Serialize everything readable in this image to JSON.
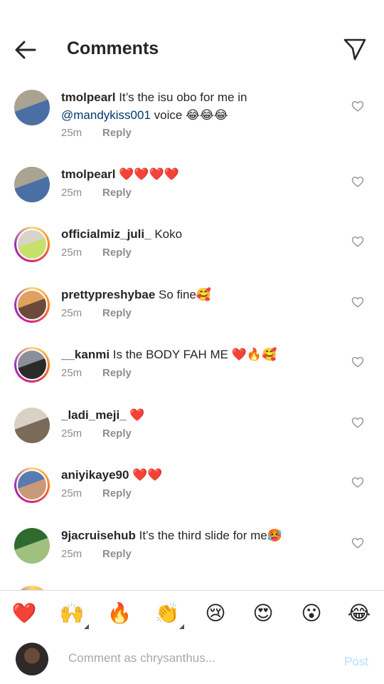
{
  "header": {
    "title": "Comments",
    "back_icon": "arrow-left-icon",
    "send_icon": "paper-plane-icon"
  },
  "comments": [
    {
      "user": "tmolpearl",
      "text_before": " It’s the isu obo for me in",
      "mention": "@mandykiss001",
      "text_after": " voice 😂😂😂",
      "time": "25m",
      "reply": "Reply",
      "story_ring": false,
      "avatar_colors": [
        "#a9a391",
        "#4a6fa5"
      ]
    },
    {
      "user": "tmolpearl",
      "text_before": " ❤️❤️❤️❤️",
      "mention": "",
      "text_after": "",
      "time": "25m",
      "reply": "Reply",
      "story_ring": false,
      "avatar_colors": [
        "#a9a391",
        "#4a6fa5"
      ]
    },
    {
      "user": "officialmiz_juli_",
      "text_before": " Koko",
      "mention": "",
      "text_after": "",
      "time": "25m",
      "reply": "Reply",
      "story_ring": true,
      "avatar_colors": [
        "#d9d3c7",
        "#c7e06a"
      ]
    },
    {
      "user": "prettypreshybae",
      "text_before": " So fine🥰",
      "mention": "",
      "text_after": "",
      "time": "25m",
      "reply": "Reply",
      "story_ring": true,
      "avatar_colors": [
        "#e0a060",
        "#6a4a3a"
      ]
    },
    {
      "user": "__kanmi",
      "text_before": " Is the BODY FAH ME ❤️🔥🥰",
      "mention": "",
      "text_after": "",
      "time": "25m",
      "reply": "Reply",
      "story_ring": true,
      "avatar_colors": [
        "#8a8f99",
        "#2a2a2a"
      ]
    },
    {
      "user": "_ladi_meji_",
      "text_before": " ❤️",
      "mention": "",
      "text_after": "",
      "time": "25m",
      "reply": "Reply",
      "story_ring": false,
      "avatar_colors": [
        "#d8d2c6",
        "#7a6a5a"
      ]
    },
    {
      "user": "aniyikaye90",
      "text_before": " ❤️❤️",
      "mention": "",
      "text_after": "",
      "time": "25m",
      "reply": "Reply",
      "story_ring": true,
      "avatar_colors": [
        "#5a7ab0",
        "#c89a7a"
      ]
    },
    {
      "user": "9jacruisehub",
      "text_before": " It’s the third slide for me🥵",
      "mention": "",
      "text_after": "",
      "time": "25m",
      "reply": "Reply",
      "story_ring": false,
      "avatar_colors": [
        "#2f6b2f",
        "#a0c080"
      ]
    }
  ],
  "reactions": [
    {
      "emoji": "❤️",
      "icon": "red-heart-icon",
      "has_variants": false
    },
    {
      "emoji": "🙌",
      "icon": "raising-hands-icon",
      "has_variants": true
    },
    {
      "emoji": "🔥",
      "icon": "fire-icon",
      "has_variants": false
    },
    {
      "emoji": "👏",
      "icon": "clapping-hands-icon",
      "has_variants": true
    },
    {
      "emoji": "😢",
      "icon": "crying-face-icon",
      "has_variants": false
    },
    {
      "emoji": "😍",
      "icon": "heart-eyes-icon",
      "has_variants": false
    },
    {
      "emoji": "😮",
      "icon": "surprised-face-icon",
      "has_variants": false
    },
    {
      "emoji": "😂",
      "icon": "tears-of-joy-icon",
      "has_variants": false
    }
  ],
  "composer": {
    "placeholder": "Comment as chrysanthus...",
    "post_label": "Post"
  },
  "colors": {
    "text": "#262626",
    "meta": "#8e8e8e",
    "mention": "#00376b",
    "post_disabled": "#b2dffc",
    "divider": "#dbdbdb"
  }
}
